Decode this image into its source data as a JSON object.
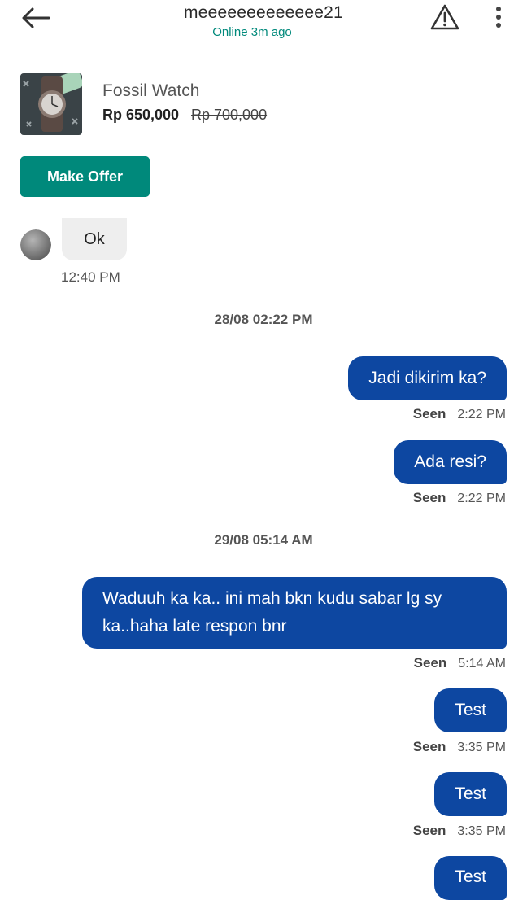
{
  "header": {
    "title": "meeeeeeeeeeeee21",
    "status": "Online 3m ago"
  },
  "product": {
    "name": "Fossil Watch",
    "price": "Rp 650,000",
    "original_price": "Rp 700,000",
    "offer_button": "Make Offer"
  },
  "incoming": {
    "text": "Ok",
    "time": "12:40 PM"
  },
  "dates": [
    "28/08 02:22 PM",
    "29/08 05:14 AM"
  ],
  "outgoing": [
    {
      "text": "Jadi dikirim ka?",
      "seen": "Seen",
      "time": "2:22 PM"
    },
    {
      "text": "Ada resi?",
      "seen": "Seen",
      "time": "2:22 PM"
    },
    {
      "text": "Waduuh ka ka.. ini mah bkn kudu sabar lg sy ka..haha late respon bnr",
      "seen": "Seen",
      "time": "5:14 AM"
    },
    {
      "text": "Test",
      "seen": "Seen",
      "time": "3:35 PM"
    },
    {
      "text": "Test",
      "seen": "Seen",
      "time": "3:35 PM"
    },
    {
      "text": "Test"
    }
  ],
  "colors": {
    "accent_green": "#00897b",
    "bubble_blue": "#0d47a1"
  },
  "icons": [
    "back-arrow-icon",
    "warning-icon",
    "more-vertical-icon"
  ]
}
